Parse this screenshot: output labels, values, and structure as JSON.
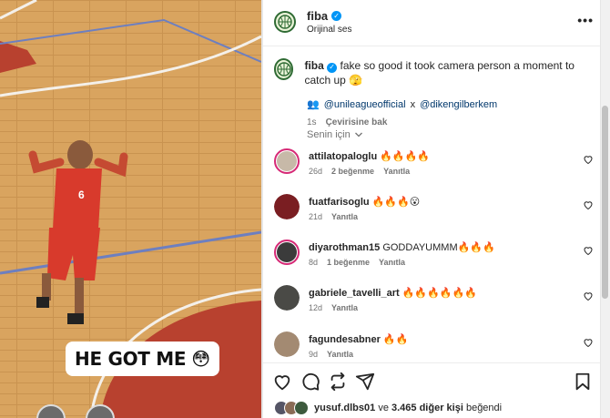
{
  "video": {
    "caption_text": "HE GOT ME",
    "caption_emoji": "😳",
    "jersey_number": "6"
  },
  "post": {
    "account": "fiba",
    "audio": "Orijinal ses",
    "caption_user": "fiba",
    "caption_text": "fake so good it took camera person a moment to catch up 🫣",
    "tag_1": "@unileagueofficial",
    "tag_sep": "x",
    "tag_2": "@dikengilberkem",
    "age": "1s",
    "translate": "Çevirisine bak",
    "sort_label": "Senin için"
  },
  "comments": [
    {
      "user": "attilatopaloglu",
      "text": "🔥🔥🔥🔥",
      "age": "26d",
      "likes": "2 beğenme",
      "reply": "Yanıtla",
      "avatar_color": "#c7b9a8",
      "ring": true
    },
    {
      "user": "fuatfarisoglu",
      "text": "🔥🔥🔥😮",
      "age": "21d",
      "likes": "",
      "reply": "Yanıtla",
      "avatar_color": "#7a1e22",
      "ring": false
    },
    {
      "user": "diyarothman15",
      "text": "GODDAYUMMM🔥🔥🔥",
      "age": "8d",
      "likes": "1 beğenme",
      "reply": "Yanıtla",
      "avatar_color": "#3b3b3b",
      "ring": true
    },
    {
      "user": "gabriele_tavelli_art",
      "text": "🔥🔥🔥🔥🔥🔥",
      "age": "12d",
      "likes": "",
      "reply": "Yanıtla",
      "avatar_color": "#4a4a46",
      "ring": false
    },
    {
      "user": "fagundesabner",
      "text": "🔥🔥",
      "age": "9d",
      "likes": "",
      "reply": "Yanıtla",
      "avatar_color": "#a38a72",
      "ring": false
    }
  ],
  "likes_line": {
    "first_user": "yusuf.dlbs01",
    "connector": "ve",
    "others": "3.465 diğer kişi",
    "suffix": "beğendi"
  },
  "icons": [
    "more-icon",
    "verified-icon",
    "heart-icon",
    "comment-icon",
    "repost-icon",
    "share-icon",
    "save-icon",
    "chevron-down-icon"
  ],
  "colors": {
    "link": "#00376b",
    "verified": "#0095f6",
    "muted": "#737373",
    "story_ring": "#d62976",
    "court": "#d6a15c",
    "jersey": "#d83a2c"
  }
}
